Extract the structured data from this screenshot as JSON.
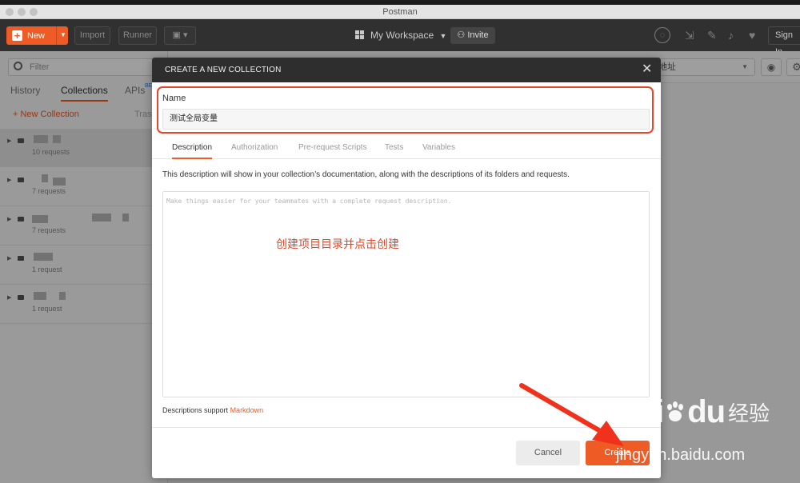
{
  "window": {
    "title": "Postman"
  },
  "toolbar": {
    "new_label": "New",
    "import_label": "Import",
    "runner_label": "Runner",
    "workspace_label": "My Workspace",
    "invite_label": "Invite",
    "signin_label": "Sign In"
  },
  "sidebar": {
    "filter_placeholder": "Filter",
    "tabs": [
      "History",
      "Collections",
      "APIs"
    ],
    "beta_badge": "BETA",
    "new_collection_label": "+ New Collection",
    "trash_label": "Trash",
    "collections": [
      {
        "meta": "10 requests"
      },
      {
        "meta": "7 requests"
      },
      {
        "meta": "7 requests"
      },
      {
        "meta": "1 request"
      },
      {
        "meta": "1 request"
      }
    ]
  },
  "env": {
    "selected": "地址"
  },
  "modal": {
    "title": "CREATE A NEW COLLECTION",
    "name_label": "Name",
    "name_value": "测试全局变量",
    "tabs": [
      "Description",
      "Authorization",
      "Pre-request Scripts",
      "Tests",
      "Variables"
    ],
    "help_text": "This description will show in your collection’s documentation, along with the descriptions of its folders and requests.",
    "description_placeholder": "Make things easier for your teammates with a complete request description.",
    "annotation": "创建项目目录并点击创建",
    "markdown_prefix": "Descriptions support",
    "markdown_link": "Markdown",
    "cancel_label": "Cancel",
    "create_label": "Create"
  },
  "watermark": {
    "brand": "Bai",
    "brand_tail": "du",
    "cn": "经验",
    "url": "jingyan.baidu.com"
  },
  "colors": {
    "accent": "#ef5b25",
    "annotation_red": "#e8462a",
    "dark_header": "#2e2e2e"
  }
}
